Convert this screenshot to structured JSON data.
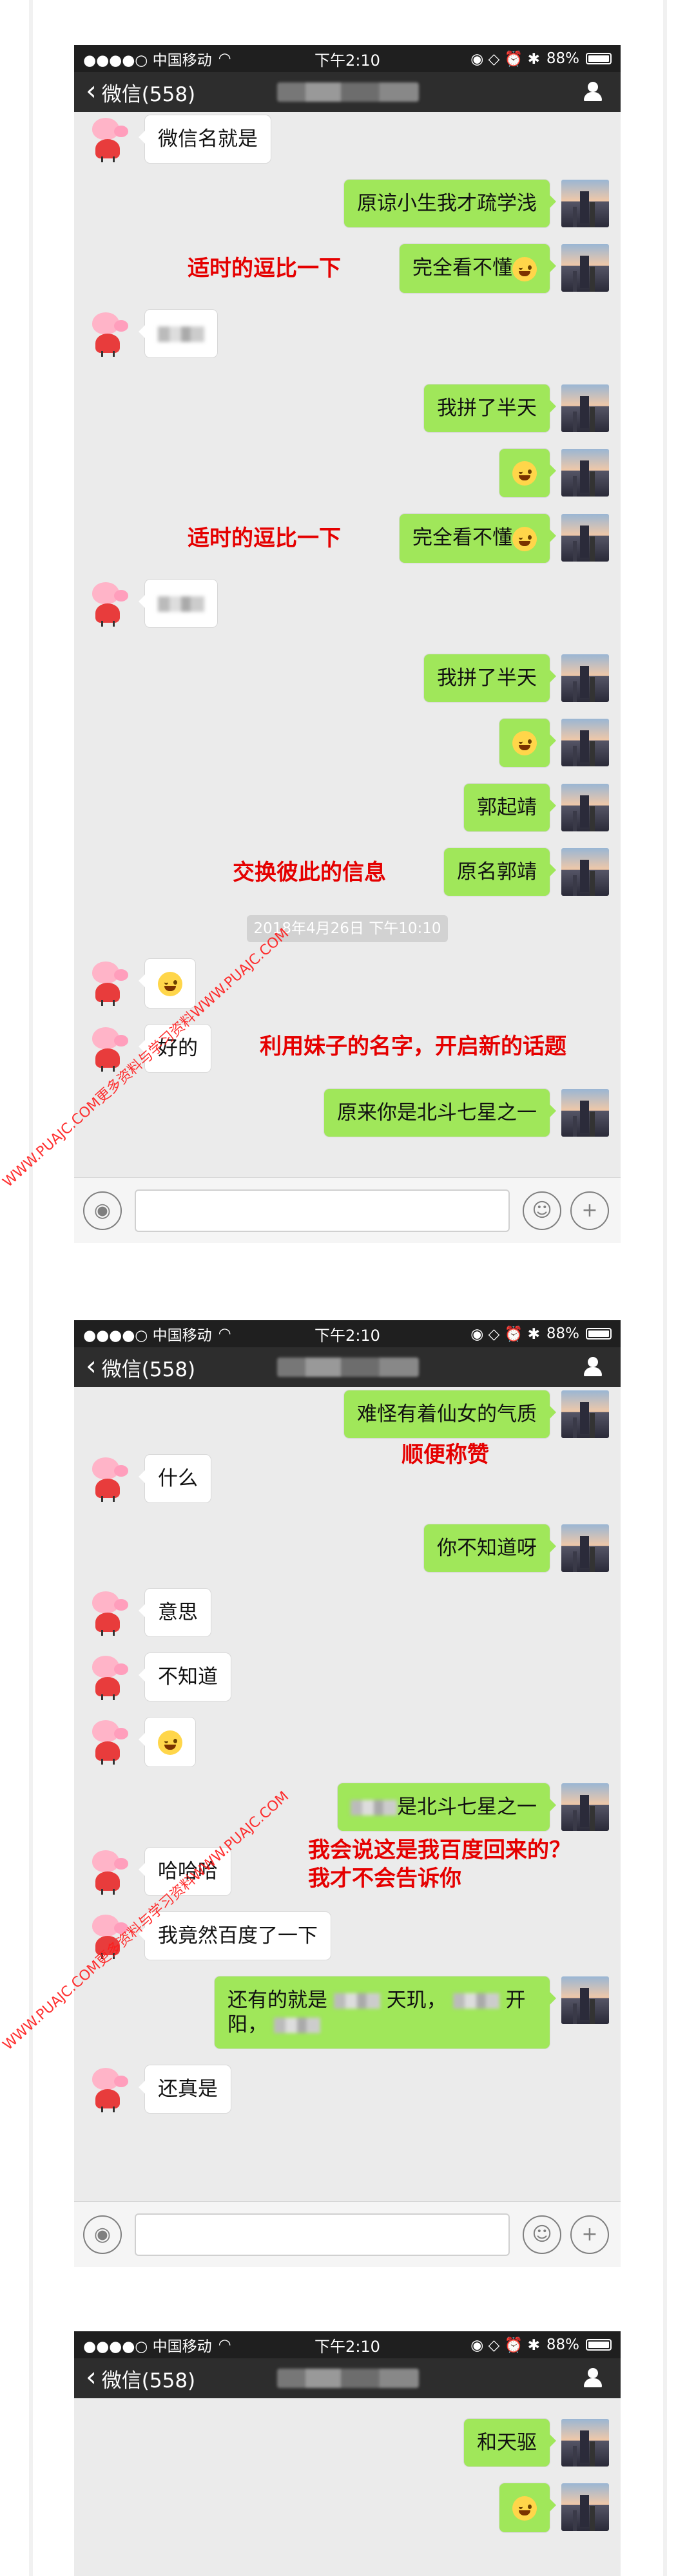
{
  "status": {
    "carrier": "●●●●○ 中国移动",
    "wifi": "◠",
    "time": "下午2:10",
    "right_icons": "◉ ◇ ⏰ ✱",
    "battery_text": "88%"
  },
  "nav": {
    "back_label": "微信(558)",
    "chevron": "‹"
  },
  "screen1": {
    "messages": [
      "微信名就是",
      "原谅小生我才疏学浅",
      "完全看不懂",
      "我拼了半天",
      "完全看不懂",
      "我拼了半天",
      "郭起靖",
      "原名郭靖",
      "好的",
      "原来你是北斗七星之一"
    ],
    "timestamp": "2018年4月26日 下午10:10",
    "annotations": {
      "humor_1": "适时的逗比一下",
      "humor_2": "适时的逗比一下",
      "exchange": "交换彼此的信息",
      "topic": "利用妹子的名字，开启新的话题"
    }
  },
  "screen2": {
    "messages": [
      "难怪有着仙女的气质",
      "什么",
      "你不知道呀",
      "意思",
      "不知道",
      "是北斗七星之一",
      "哈哈哈",
      "我竟然百度了一下",
      "还有的就是",
      "天玑，",
      "开",
      "阳，",
      "还真是"
    ],
    "annotations": {
      "praise": "顺便称赞",
      "search_1": "我会说这是我百度回来的？",
      "search_2": "我才不会告诉你"
    }
  },
  "screen3": {
    "messages": [
      "和天驱"
    ]
  },
  "watermark": "WWW.PUAJC.COM更多资料与学习资料WWW.PUAJC.COM",
  "icons": {
    "voice": "◉",
    "emoji": "☺",
    "add": "+"
  },
  "colors": {
    "sent": "#a0e75a",
    "received": "#ffffff",
    "nav": "#2d2d2d",
    "annotation": "#e50000"
  }
}
